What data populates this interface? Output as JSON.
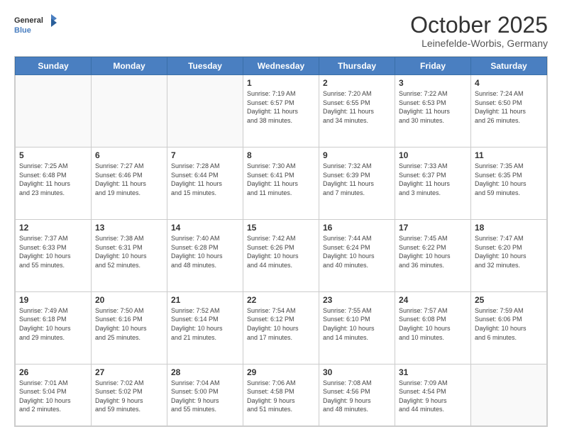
{
  "header": {
    "logo_general": "General",
    "logo_blue": "Blue",
    "month_title": "October 2025",
    "location": "Leinefelde-Worbis, Germany"
  },
  "days_of_week": [
    "Sunday",
    "Monday",
    "Tuesday",
    "Wednesday",
    "Thursday",
    "Friday",
    "Saturday"
  ],
  "weeks": [
    [
      {
        "day": "",
        "text": ""
      },
      {
        "day": "",
        "text": ""
      },
      {
        "day": "",
        "text": ""
      },
      {
        "day": "1",
        "text": "Sunrise: 7:19 AM\nSunset: 6:57 PM\nDaylight: 11 hours\nand 38 minutes."
      },
      {
        "day": "2",
        "text": "Sunrise: 7:20 AM\nSunset: 6:55 PM\nDaylight: 11 hours\nand 34 minutes."
      },
      {
        "day": "3",
        "text": "Sunrise: 7:22 AM\nSunset: 6:53 PM\nDaylight: 11 hours\nand 30 minutes."
      },
      {
        "day": "4",
        "text": "Sunrise: 7:24 AM\nSunset: 6:50 PM\nDaylight: 11 hours\nand 26 minutes."
      }
    ],
    [
      {
        "day": "5",
        "text": "Sunrise: 7:25 AM\nSunset: 6:48 PM\nDaylight: 11 hours\nand 23 minutes."
      },
      {
        "day": "6",
        "text": "Sunrise: 7:27 AM\nSunset: 6:46 PM\nDaylight: 11 hours\nand 19 minutes."
      },
      {
        "day": "7",
        "text": "Sunrise: 7:28 AM\nSunset: 6:44 PM\nDaylight: 11 hours\nand 15 minutes."
      },
      {
        "day": "8",
        "text": "Sunrise: 7:30 AM\nSunset: 6:41 PM\nDaylight: 11 hours\nand 11 minutes."
      },
      {
        "day": "9",
        "text": "Sunrise: 7:32 AM\nSunset: 6:39 PM\nDaylight: 11 hours\nand 7 minutes."
      },
      {
        "day": "10",
        "text": "Sunrise: 7:33 AM\nSunset: 6:37 PM\nDaylight: 11 hours\nand 3 minutes."
      },
      {
        "day": "11",
        "text": "Sunrise: 7:35 AM\nSunset: 6:35 PM\nDaylight: 10 hours\nand 59 minutes."
      }
    ],
    [
      {
        "day": "12",
        "text": "Sunrise: 7:37 AM\nSunset: 6:33 PM\nDaylight: 10 hours\nand 55 minutes."
      },
      {
        "day": "13",
        "text": "Sunrise: 7:38 AM\nSunset: 6:31 PM\nDaylight: 10 hours\nand 52 minutes."
      },
      {
        "day": "14",
        "text": "Sunrise: 7:40 AM\nSunset: 6:28 PM\nDaylight: 10 hours\nand 48 minutes."
      },
      {
        "day": "15",
        "text": "Sunrise: 7:42 AM\nSunset: 6:26 PM\nDaylight: 10 hours\nand 44 minutes."
      },
      {
        "day": "16",
        "text": "Sunrise: 7:44 AM\nSunset: 6:24 PM\nDaylight: 10 hours\nand 40 minutes."
      },
      {
        "day": "17",
        "text": "Sunrise: 7:45 AM\nSunset: 6:22 PM\nDaylight: 10 hours\nand 36 minutes."
      },
      {
        "day": "18",
        "text": "Sunrise: 7:47 AM\nSunset: 6:20 PM\nDaylight: 10 hours\nand 32 minutes."
      }
    ],
    [
      {
        "day": "19",
        "text": "Sunrise: 7:49 AM\nSunset: 6:18 PM\nDaylight: 10 hours\nand 29 minutes."
      },
      {
        "day": "20",
        "text": "Sunrise: 7:50 AM\nSunset: 6:16 PM\nDaylight: 10 hours\nand 25 minutes."
      },
      {
        "day": "21",
        "text": "Sunrise: 7:52 AM\nSunset: 6:14 PM\nDaylight: 10 hours\nand 21 minutes."
      },
      {
        "day": "22",
        "text": "Sunrise: 7:54 AM\nSunset: 6:12 PM\nDaylight: 10 hours\nand 17 minutes."
      },
      {
        "day": "23",
        "text": "Sunrise: 7:55 AM\nSunset: 6:10 PM\nDaylight: 10 hours\nand 14 minutes."
      },
      {
        "day": "24",
        "text": "Sunrise: 7:57 AM\nSunset: 6:08 PM\nDaylight: 10 hours\nand 10 minutes."
      },
      {
        "day": "25",
        "text": "Sunrise: 7:59 AM\nSunset: 6:06 PM\nDaylight: 10 hours\nand 6 minutes."
      }
    ],
    [
      {
        "day": "26",
        "text": "Sunrise: 7:01 AM\nSunset: 5:04 PM\nDaylight: 10 hours\nand 2 minutes."
      },
      {
        "day": "27",
        "text": "Sunrise: 7:02 AM\nSunset: 5:02 PM\nDaylight: 9 hours\nand 59 minutes."
      },
      {
        "day": "28",
        "text": "Sunrise: 7:04 AM\nSunset: 5:00 PM\nDaylight: 9 hours\nand 55 minutes."
      },
      {
        "day": "29",
        "text": "Sunrise: 7:06 AM\nSunset: 4:58 PM\nDaylight: 9 hours\nand 51 minutes."
      },
      {
        "day": "30",
        "text": "Sunrise: 7:08 AM\nSunset: 4:56 PM\nDaylight: 9 hours\nand 48 minutes."
      },
      {
        "day": "31",
        "text": "Sunrise: 7:09 AM\nSunset: 4:54 PM\nDaylight: 9 hours\nand 44 minutes."
      },
      {
        "day": "",
        "text": ""
      }
    ]
  ]
}
